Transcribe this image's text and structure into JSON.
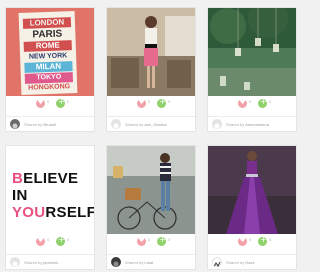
{
  "cards": [
    {
      "image_icon": "city-names-poster-image",
      "poster": {
        "lines": [
          "LONDON",
          "PARIS",
          "ROME",
          "NEW YORK",
          "MILAN",
          "TOKYO",
          "HONGKONG"
        ]
      },
      "likes": "0",
      "adds": "0",
      "shared_label": "Shared by",
      "username": "Bruanti"
    },
    {
      "image_icon": "woman-fashion-photo",
      "likes": "0",
      "adds": "0",
      "shared_label": "Shared by",
      "username": "ann_Slomka"
    },
    {
      "image_icon": "tree-lanterns-photo",
      "likes": "0",
      "adds": "0",
      "shared_label": "Shared by",
      "username": "Anemaxtrena"
    },
    {
      "image_icon": "believe-in-yourself-quote",
      "quote": {
        "line1_pink": "B",
        "line1_rest": "ELIEVE IN",
        "line2_pink": "YOU",
        "line2_rest": "RSELF"
      },
      "likes": "0",
      "adds": "0",
      "shared_label": "Shared by",
      "username": "jameshk"
    },
    {
      "image_icon": "bicycle-fashion-photo",
      "likes": "0",
      "adds": "0",
      "shared_label": "Shared by",
      "username": "Lstat"
    },
    {
      "image_icon": "purple-dress-photo",
      "likes": "0",
      "adds": "0",
      "shared_label": "Shared by",
      "username": "Haze"
    }
  ]
}
